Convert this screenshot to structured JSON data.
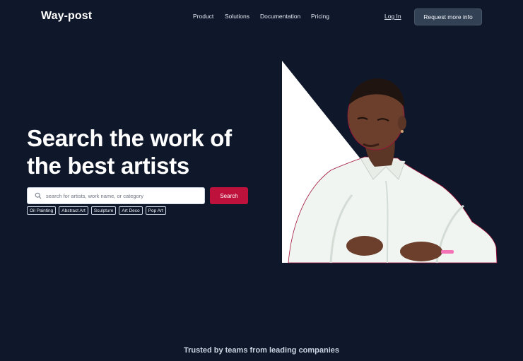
{
  "brand": {
    "name": "Way-post"
  },
  "nav": {
    "items": [
      {
        "label": "Product"
      },
      {
        "label": "Solutions"
      },
      {
        "label": "Documentation"
      },
      {
        "label": "Pricing"
      }
    ],
    "login_label": "Log In",
    "cta_label": "Request more info"
  },
  "hero": {
    "headline_line1": "Search the work of",
    "headline_line2": "the best artists",
    "search": {
      "placeholder": "search for artists, work name, or category",
      "button_label": "Search",
      "icon": "search-icon"
    },
    "tags": [
      {
        "label": "Oil Painting"
      },
      {
        "label": "Abstract Art"
      },
      {
        "label": "Sculpture"
      },
      {
        "label": "Art Deco"
      },
      {
        "label": "Pop Art"
      }
    ]
  },
  "trusted": {
    "text": "Trusted by teams from leading companies"
  },
  "colors": {
    "background": "#0f172a",
    "accent": "#be123c",
    "cta_bg": "#334155",
    "text": "#ffffff"
  }
}
